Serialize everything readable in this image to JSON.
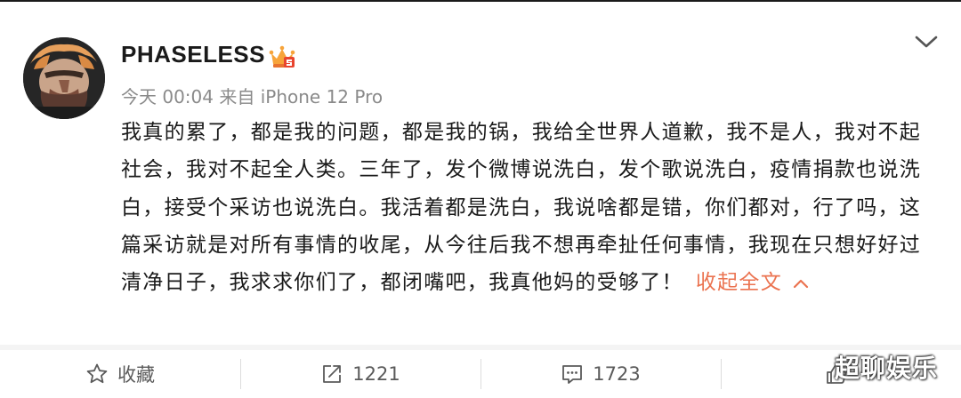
{
  "post": {
    "username": "PHASELESS",
    "meta": "今天 00:04 来自 iPhone 12 Pro",
    "content": "我真的累了，都是我的问题，都是我的锅，我给全世界人道歉，我不是人，我对不起社会，我对不起全人类。三年了，发个微博说洗白，发个歌说洗白，疫情捐款也说洗白，接受个采访也说洗白。我活着都是洗白，我说啥都是错，你们都对，行了吗，这篇采访就是对所有事情的收尾，从今往后我不想再牵扯任何事情，我现在只想好好过清净日子，我求求你们了，都闭嘴吧，我真他妈的受够了！",
    "collapse_label": "收起全文",
    "link_color": "#eb7350"
  },
  "actions": {
    "favorite": {
      "label": "收藏",
      "icon": "star-icon"
    },
    "repost": {
      "count": "1221",
      "icon": "repost-icon"
    },
    "comment": {
      "count": "1723",
      "icon": "comment-icon"
    },
    "like": {
      "icon": "thumbs-up-icon"
    }
  },
  "watermark": "超聊娱乐"
}
